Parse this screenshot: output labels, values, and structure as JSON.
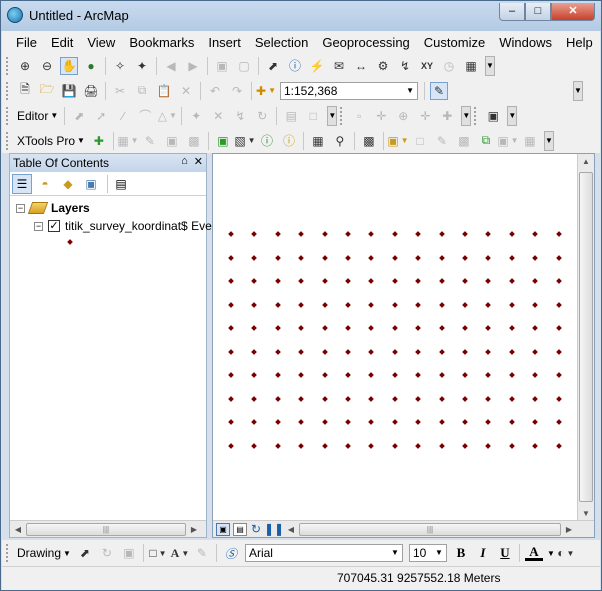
{
  "window": {
    "title": "Untitled - ArcMap",
    "minimize": "–",
    "maximize": "□",
    "close": "✕"
  },
  "menu": [
    "File",
    "Edit",
    "View",
    "Bookmarks",
    "Insert",
    "Selection",
    "Geoprocessing",
    "Customize",
    "Windows",
    "Help"
  ],
  "toolbar": {
    "scale": "1:152,368",
    "editor_label": "Editor",
    "xtools_label": "XTools Pro"
  },
  "toc": {
    "title": "Table Of Contents",
    "pin": "⌂",
    "close": "✕",
    "layers_label": "Layers",
    "layer_name": "titik_survey_koordinat$ Eve",
    "layer_checked": "✓"
  },
  "drawing": {
    "label": "Drawing",
    "font": "Arial",
    "font_size": "10",
    "bold": "B",
    "italic": "I",
    "underline": "U",
    "font_color": "A"
  },
  "status": {
    "coordinates": "707045.31  9257552.18 Meters"
  },
  "colors": {
    "point": "#7a0000",
    "title_bar": "#b4cbe4"
  }
}
